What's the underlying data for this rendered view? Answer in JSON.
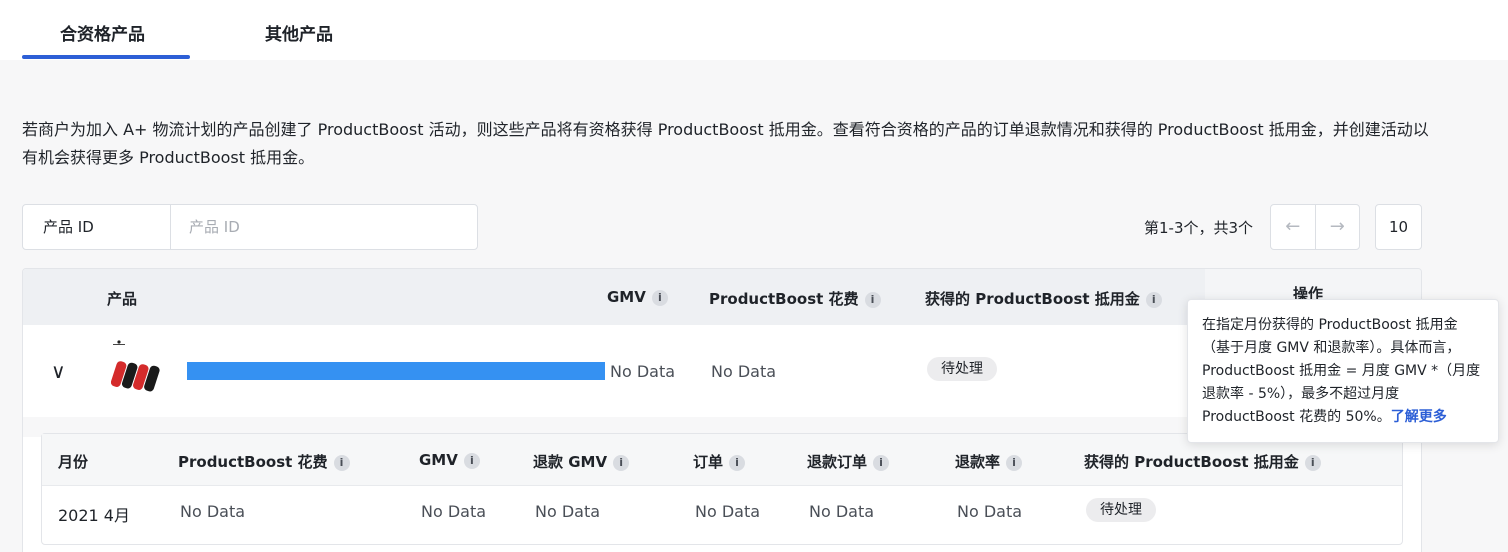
{
  "tabs": [
    {
      "label": "合资格产品"
    },
    {
      "label": "其他产品"
    }
  ],
  "intro": "若商户为加入 A+ 物流计划的产品创建了 ProductBoost 活动，则这些产品将有资格获得 ProductBoost 抵用金。查看符合资格的产品的订单退款情况和获得的 ProductBoost 抵用金，并创建活动以有机会获得更多 ProductBoost 抵用金。",
  "filter": {
    "label": "产品 ID",
    "placeholder": "产品 ID"
  },
  "pager": {
    "text": "第1-3个，共3个",
    "prev": "←",
    "next": "→",
    "page_size": "10"
  },
  "table": {
    "headers": {
      "product": "产品",
      "gmv": "GMV",
      "spend": "ProductBoost 花费",
      "credit": "获得的 ProductBoost 抵用金",
      "actions": "操作"
    },
    "info": "i",
    "row": {
      "expand": "∨",
      "gmv": "No Data",
      "spend": "No Data",
      "status": "待处理"
    },
    "sub_headers": {
      "month": "月份",
      "spend": "ProductBoost 花费",
      "gmv": "GMV",
      "refund_gmv": "退款 GMV",
      "orders": "订单",
      "refund_orders": "退款订单",
      "refund_rate": "退款率",
      "credit": "获得的 ProductBoost 抵用金"
    },
    "sub_row": {
      "month": "2021 4月",
      "spend": "No Data",
      "gmv": "No Data",
      "refund_gmv": "No Data",
      "orders": "No Data",
      "refund_orders": "No Data",
      "refund_rate": "No Data",
      "status": "待处理"
    }
  },
  "tooltip": {
    "text": "在指定月份获得的 ProductBoost 抵用金（基于月度 GMV 和退款率）。具体而言，ProductBoost 抵用金 = 月度 GMV *（月度退款率 - 5%），最多不超过月度 ProductBoost 花费的 50%。",
    "link": "了解更多"
  },
  "colors": {
    "accent": "#2d5fd6",
    "redaction": "#3591f2"
  }
}
